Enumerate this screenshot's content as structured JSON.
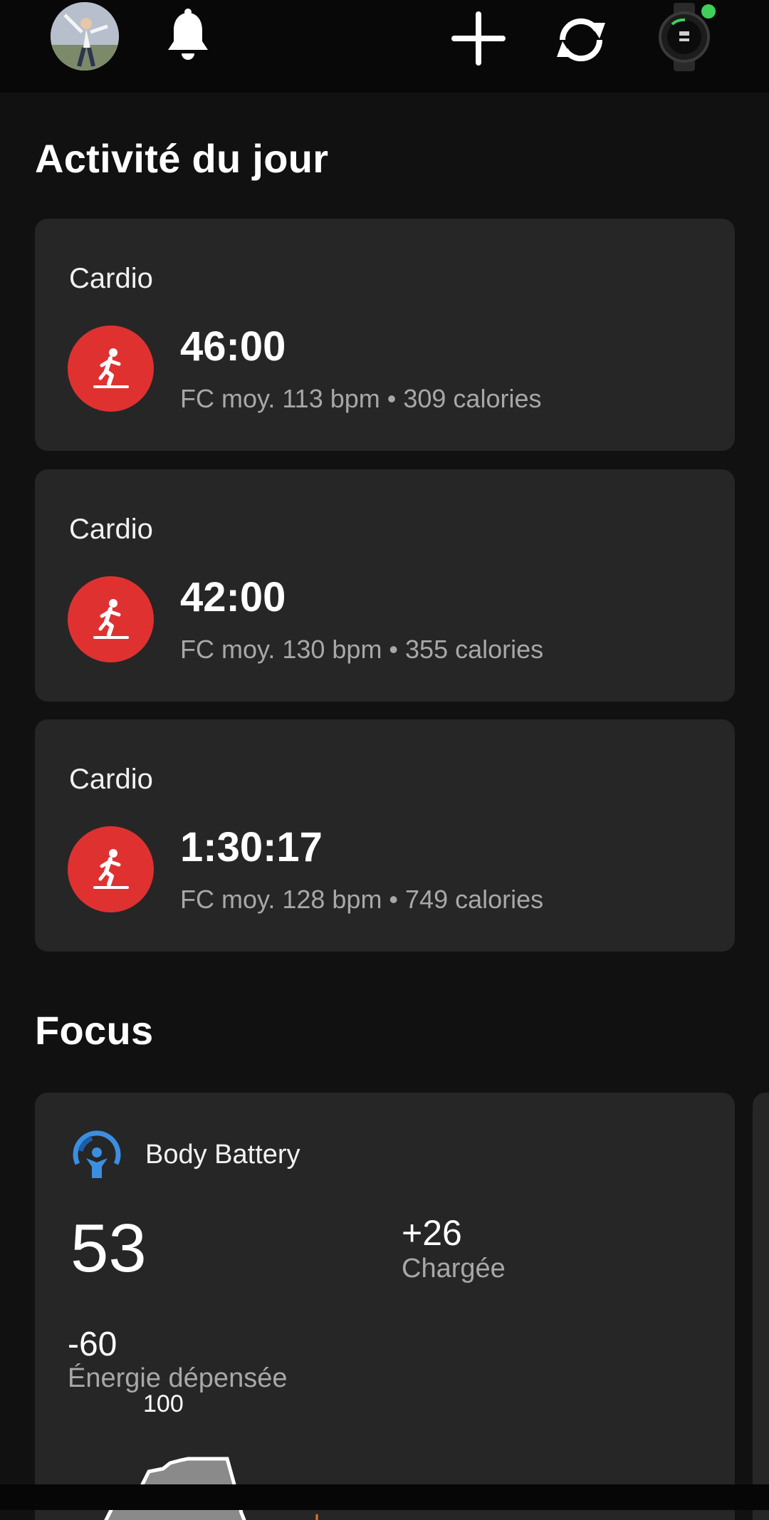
{
  "header": {
    "icons": [
      "avatar",
      "bell-icon",
      "plus-icon",
      "sync-icon",
      "watch-icon"
    ],
    "watch_status_color": "#3fcf5a"
  },
  "today": {
    "title": "Activité du jour",
    "activities": [
      {
        "label": "Cardio",
        "duration": "46:00",
        "stats": "FC moy. 113 bpm • 309 calories"
      },
      {
        "label": "Cardio",
        "duration": "42:00",
        "stats": "FC moy. 130 bpm • 355 calories"
      },
      {
        "label": "Cardio",
        "duration": "1:30:17",
        "stats": "FC moy. 128 bpm • 749 calories"
      }
    ],
    "activity_icon": "treadmill-runner-icon",
    "activity_color": "#e03131"
  },
  "focus": {
    "title": "Focus",
    "body_battery": {
      "title": "Body Battery",
      "value": "53",
      "charged_value": "+26",
      "charged_label": "Chargée",
      "spent_value": "-60",
      "spent_label": "Énergie dépensée",
      "chart_max_label": "100",
      "accent": "#3b8fe0"
    }
  }
}
